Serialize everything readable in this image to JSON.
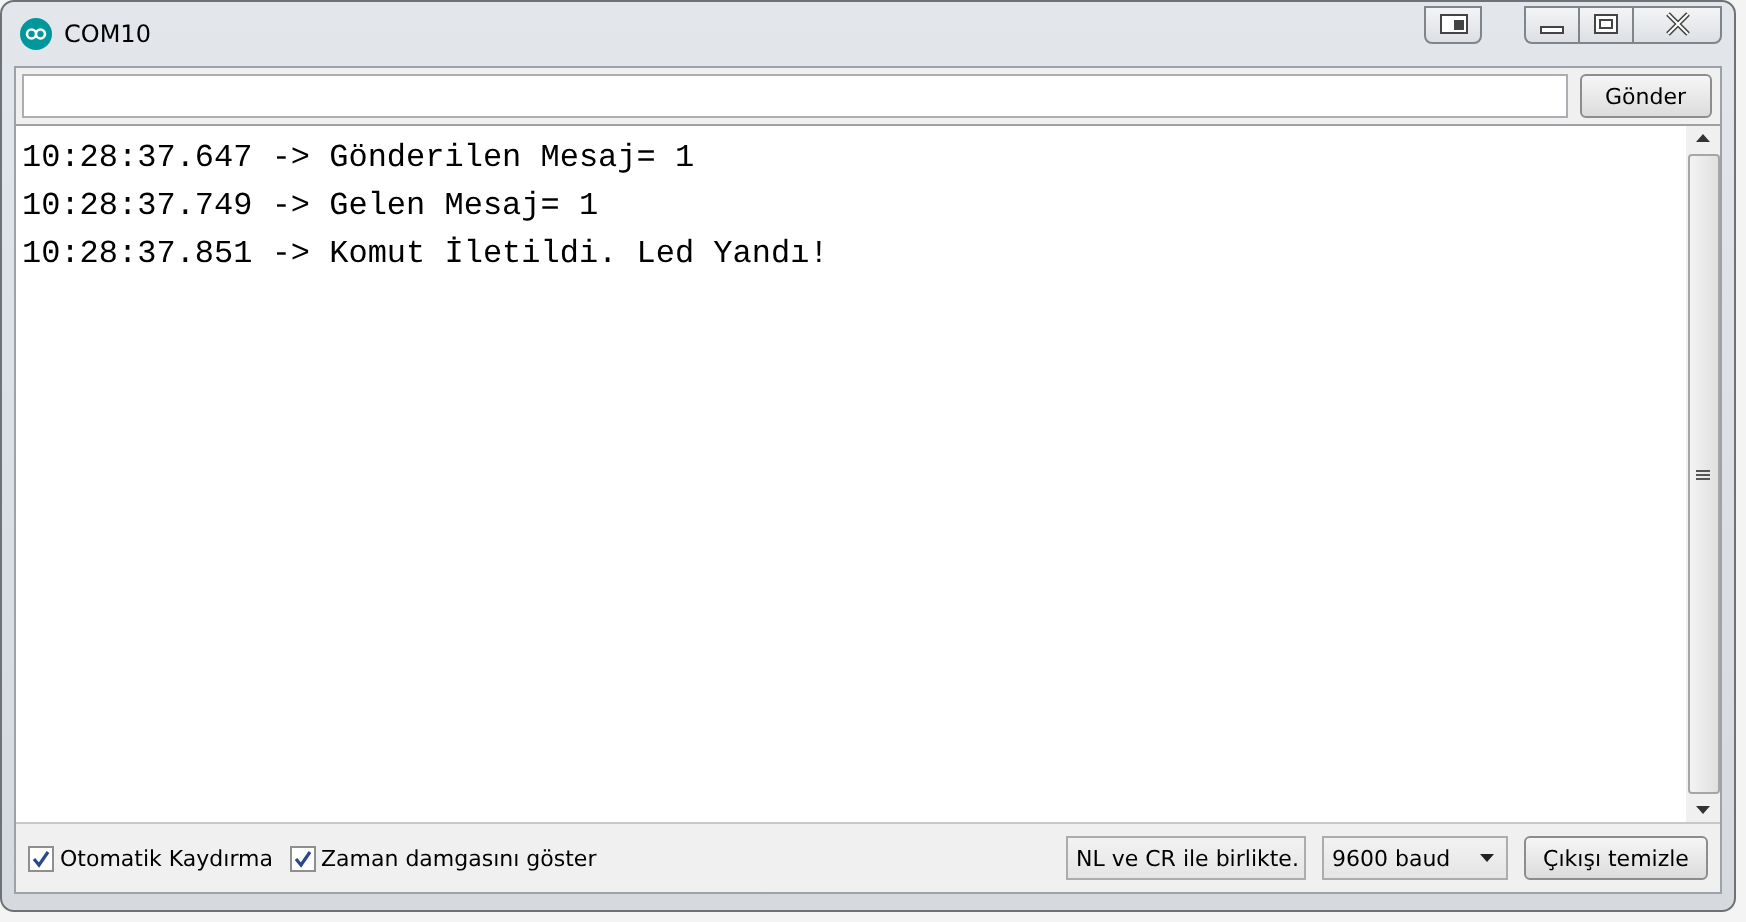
{
  "window": {
    "title": "COM10"
  },
  "send": {
    "button": "Gönder"
  },
  "output": {
    "lines": [
      "10:28:37.647 -> Gönderilen Mesaj= 1",
      "10:28:37.749 -> Gelen Mesaj= 1",
      "10:28:37.851 -> Komut İletildi. Led Yandı!"
    ]
  },
  "options": [
    {
      "label": "Otomatik Kaydırma",
      "checked": true
    },
    {
      "label": "Zaman damgasını göster",
      "checked": true
    }
  ],
  "line_ending": {
    "value": "NL ve CR ile birlikte."
  },
  "baud": {
    "value": "9600 baud"
  },
  "clear_button": "Çıkışı temizle"
}
